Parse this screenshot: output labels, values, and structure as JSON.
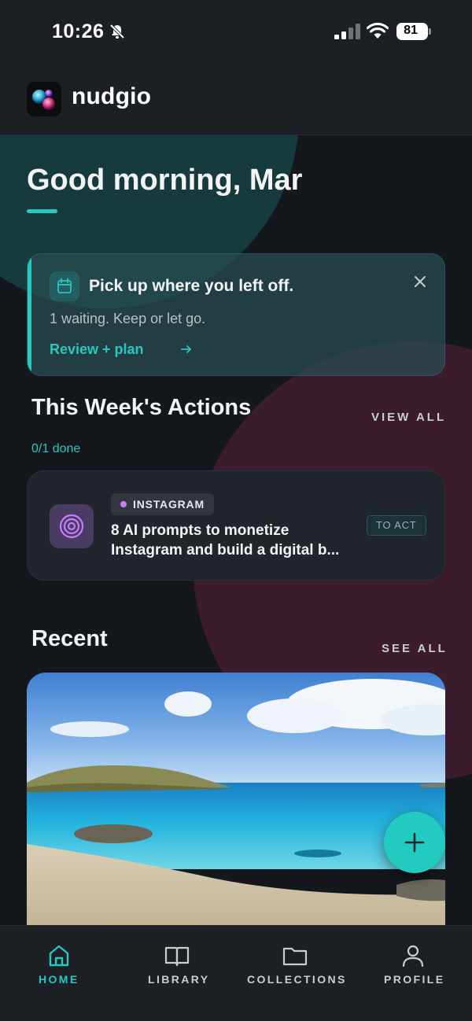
{
  "status_bar": {
    "time": "10:26",
    "battery": "81"
  },
  "app": {
    "name": "nudgio"
  },
  "greeting": "Good morning, Mar",
  "pickup_card": {
    "title": "Pick up where you left off.",
    "subtitle": "1 waiting. Keep or let go.",
    "link": "Review + plan"
  },
  "actions": {
    "title": "This Week's Actions",
    "view_all": "VIEW ALL",
    "progress": "0/1 done",
    "items": [
      {
        "platform": "INSTAGRAM",
        "title": "8 AI prompts to monetize Instagram and build a digital b...",
        "status": "TO ACT"
      }
    ]
  },
  "recent": {
    "title": "Recent",
    "see_all": "SEE ALL"
  },
  "tabs": [
    {
      "label": "HOME",
      "active": true
    },
    {
      "label": "LIBRARY",
      "active": false
    },
    {
      "label": "COLLECTIONS",
      "active": false
    },
    {
      "label": "PROFILE",
      "active": false
    }
  ],
  "colors": {
    "accent": "#27c8c0",
    "background": "#14171c",
    "platform_dot": "#c77dff"
  }
}
